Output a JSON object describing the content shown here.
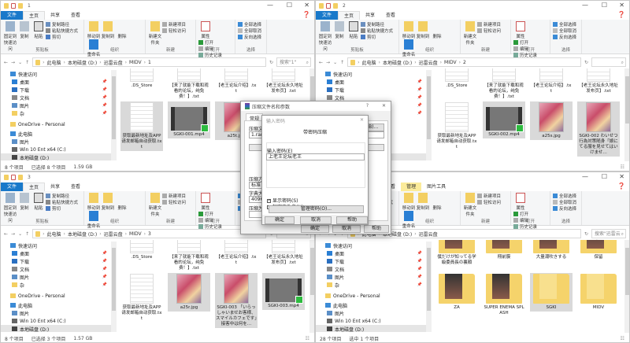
{
  "ribbon": {
    "tabs": [
      "文件",
      "主页",
      "共享",
      "查看"
    ],
    "groups": {
      "clipboard": {
        "label": "剪贴板",
        "pin": "固定到快速访问",
        "copy": "复制",
        "paste": "粘贴",
        "copy_path": "复制路径",
        "paste_shortcut": "粘贴快捷方式",
        "cut": "剪切"
      },
      "organize": {
        "label": "组织",
        "move_to": "移动到",
        "copy_to": "复制到",
        "delete": "删除",
        "rename": "重命名"
      },
      "new": {
        "label": "新建",
        "new_folder": "新建文件夹",
        "new_item": "新建项目",
        "easy_access": "轻松访问"
      },
      "open": {
        "label": "打开",
        "properties": "属性",
        "open": "打开",
        "edit": "编辑",
        "history": "历史记录"
      },
      "select": {
        "label": "选择",
        "select_all": "全部选择",
        "select_none": "全部取消",
        "invert": "反向选择"
      }
    }
  },
  "nav": [
    "快速访问",
    "桌面",
    "下载",
    "文档",
    "图片",
    "杂",
    "OneDrive - Personal",
    "此电脑",
    "图片",
    "Win 10 Ent x64 (C:)",
    "本地磁盘 (D:)"
  ],
  "windows": [
    {
      "title": "1",
      "path": [
        "此电脑",
        "本地磁盘 (D:)",
        "迅雷云盘",
        "MIDV",
        "1"
      ],
      "search": "搜索\"1\"",
      "items": [
        {
          "name": ".DS_Store",
          "type": "doc"
        },
        {
          "name": "【来了就能下载和观看的论坛，纯免费！】.txt",
          "type": "doc"
        },
        {
          "name": "【老王论坛介绍】.txt",
          "type": "doc"
        },
        {
          "name": "【老王论坛永久地址发布页】.txt",
          "type": "doc"
        },
        {
          "name": "获取最新地址及APP请发邮箱自动获取.txt",
          "type": "doc",
          "sel": true
        },
        {
          "name": "SGKI-001.mp4",
          "type": "vid",
          "sel": true
        },
        {
          "name": "a25t.jpg",
          "type": "img",
          "sel": true
        }
      ],
      "status": {
        "count": "8 个项目",
        "selected": "已选择 8 个项目",
        "size": "1.59 GB"
      }
    },
    {
      "title": "2",
      "path": [
        "此电脑",
        "本地磁盘 (D:)",
        "迅雷云盘",
        "MIDV",
        "2"
      ],
      "search": "",
      "items": [
        {
          "name": ".DS_Store",
          "type": "doc"
        },
        {
          "name": "【来了就能下载和观看的论坛，纯免费！】.txt",
          "type": "doc"
        },
        {
          "name": "【老王论坛介绍】.txt",
          "type": "doc"
        },
        {
          "name": "【老王论坛永久地址发布页】.txt",
          "type": "doc"
        },
        {
          "name": "获取最新地址及APP请发邮箱自动获取.txt",
          "type": "doc"
        },
        {
          "name": "SGKI-002.mp4",
          "type": "vid",
          "sel": true
        },
        {
          "name": "a25s.jpg",
          "type": "img",
          "sel": true
        },
        {
          "name": "SGKI-002 わいせつ行為対策随身「娘にてる服を見せてはいけませ…",
          "type": "img",
          "sel": true
        }
      ],
      "status": {
        "count": "",
        "selected": "",
        "size": ""
      }
    },
    {
      "title": "3",
      "path": [
        "此电脑",
        "本地磁盘 (D:)",
        "迅雷云盘",
        "MIDV",
        "3"
      ],
      "search": "",
      "items": [
        {
          "name": ".DS_Store",
          "type": "doc"
        },
        {
          "name": "【来了就能下载和观看的论坛，纯免费！】.txt",
          "type": "doc"
        },
        {
          "name": "【老王论坛介绍】.txt",
          "type": "doc"
        },
        {
          "name": "【老王论坛永久地址发布页】.txt",
          "type": "doc"
        },
        {
          "name": "获取最新地址及APP请发邮箱自动获取.txt",
          "type": "doc"
        },
        {
          "name": "a25r.jpg",
          "type": "img",
          "sel": true
        },
        {
          "name": "SGKI-003 「いらっしゃいませお客様、スマイルカフェです」接客中は何を…",
          "type": "img",
          "sel": true
        },
        {
          "name": "SGKI-003.mp4",
          "type": "vid",
          "sel": true
        }
      ],
      "status": {
        "count": "8 个项目",
        "selected": "已选择 3 个项目",
        "size": "1.57 GB"
      }
    },
    {
      "title": "迅雷云盘",
      "context_tab": "管理",
      "context_group": "图片工具",
      "path": [
        "此电脑",
        "本地磁盘 (D:)",
        "迅雷云盘"
      ],
      "search": "搜索\"迅雷云盘\"",
      "items": [
        {
          "name": "僕だけが知ってる学級委員長の裏顔",
          "type": "fold"
        },
        {
          "name": "翔前膜",
          "type": "fold"
        },
        {
          "name": "大量潮吹きする",
          "type": "fold"
        },
        {
          "name": "保留",
          "type": "fold"
        },
        {
          "name": "ZA",
          "type": "fold"
        },
        {
          "name": "SUPER ENEMA SPLASH",
          "type": "fold"
        },
        {
          "name": "SGKI",
          "type": "fold plain",
          "sel": true
        },
        {
          "name": "MIDV",
          "type": "fold plain"
        }
      ],
      "status": {
        "count": "28 个项目",
        "selected": "选中 1 个项目",
        "size": ""
      }
    }
  ],
  "archive_dialog": {
    "title": "压缩文件名和参数",
    "help": "?",
    "tab": "常规",
    "archive_name_label": "压缩文件名",
    "archive_name": "1.rar",
    "browse": "浏览(B)...",
    "method_label": "压缩方式",
    "method": "标准",
    "dict_label": "字典大小",
    "dict": "4096 KB",
    "split_label": "压缩为",
    "ok": "确定",
    "cancel": "取消",
    "help_btn": "帮助"
  },
  "password_dialog": {
    "title": "输入密码",
    "heading": "带密码压缩",
    "label": "输入密码(E)",
    "value": "上老王论坛老王",
    "show_password": "显示密码(S)",
    "encrypt_names": "加密文件名(N)",
    "manage": "管理密码(O)...",
    "ok": "确定",
    "cancel": "取消",
    "help": "帮助"
  }
}
